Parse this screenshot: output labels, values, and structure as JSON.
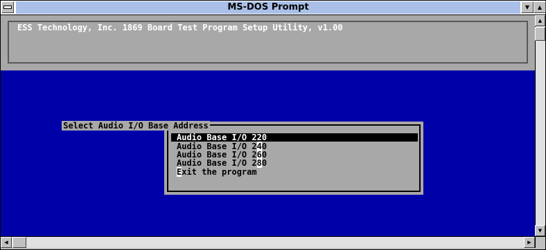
{
  "window": {
    "title": "MS-DOS Prompt",
    "minimize_glyph": "▼",
    "maximize_glyph": "▲"
  },
  "header": {
    "text": "ESS Technology, Inc. 1869 Board Test Program Setup Utility, v1.00"
  },
  "dialog": {
    "title": "Select Audio I/O Base Address",
    "items": [
      {
        "text": "Audio Base I/O 220",
        "selected": true
      },
      {
        "prefix": "Audio Base I/O 2",
        "hotkey": "4",
        "suffix": "0",
        "selected": false
      },
      {
        "prefix": "Audio Base I/O 2",
        "hotkey": "6",
        "suffix": "0",
        "selected": false
      },
      {
        "prefix": "Audio Base I/O 2",
        "hotkey": "8",
        "suffix": "0",
        "selected": false
      },
      {
        "prefix": "",
        "hotkey": "E",
        "suffix": "xit the program",
        "selected": false
      }
    ]
  },
  "scrollbars": {
    "up_glyph": "▲",
    "down_glyph": "▼",
    "left_glyph": "◀",
    "right_glyph": "▶"
  },
  "colors": {
    "dos_background": "#0000a8",
    "panel_gray": "#a8a8a8",
    "title_bar": "#aac0e8"
  }
}
